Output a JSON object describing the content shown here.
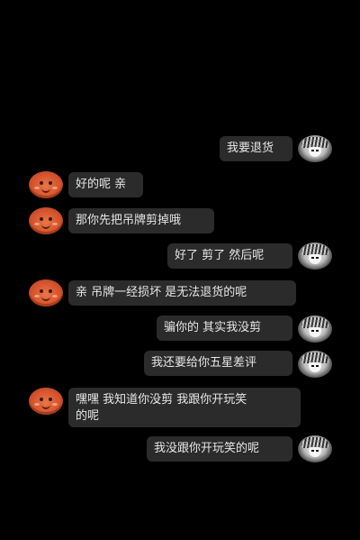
{
  "messages": [
    {
      "sender": "buyer",
      "text": "我要退货",
      "avatar_icon": "anime-sketch-avatar-icon"
    },
    {
      "sender": "seller",
      "text": "好的呢 亲",
      "avatar_icon": "orange-cartoon-face-avatar-icon"
    },
    {
      "sender": "seller",
      "text": "那你先把吊牌剪掉哦",
      "avatar_icon": "orange-cartoon-face-avatar-icon"
    },
    {
      "sender": "buyer",
      "text": "好了 剪了 然后呢",
      "avatar_icon": "anime-sketch-avatar-icon"
    },
    {
      "sender": "seller",
      "text": "亲 吊牌一经损坏 是无法退货的呢",
      "avatar_icon": "orange-cartoon-face-avatar-icon"
    },
    {
      "sender": "buyer",
      "text": "骗你的 其实我没剪",
      "avatar_icon": "anime-sketch-avatar-icon"
    },
    {
      "sender": "buyer",
      "text": "我还要给你五星差评",
      "avatar_icon": "anime-sketch-avatar-icon"
    },
    {
      "sender": "seller",
      "text_line1": "嘿嘿 我知道你没剪 我跟你开玩笑",
      "text_line2": "的呢",
      "avatar_icon": "orange-cartoon-face-avatar-icon"
    },
    {
      "sender": "buyer",
      "text": "我没跟你开玩笑的呢",
      "avatar_icon": "anime-sketch-avatar-icon"
    }
  ],
  "colors": {
    "background": "#000000",
    "bubble": "#2b2b2b",
    "text": "#e6e6e6",
    "seller_avatar": "#d6532d"
  }
}
